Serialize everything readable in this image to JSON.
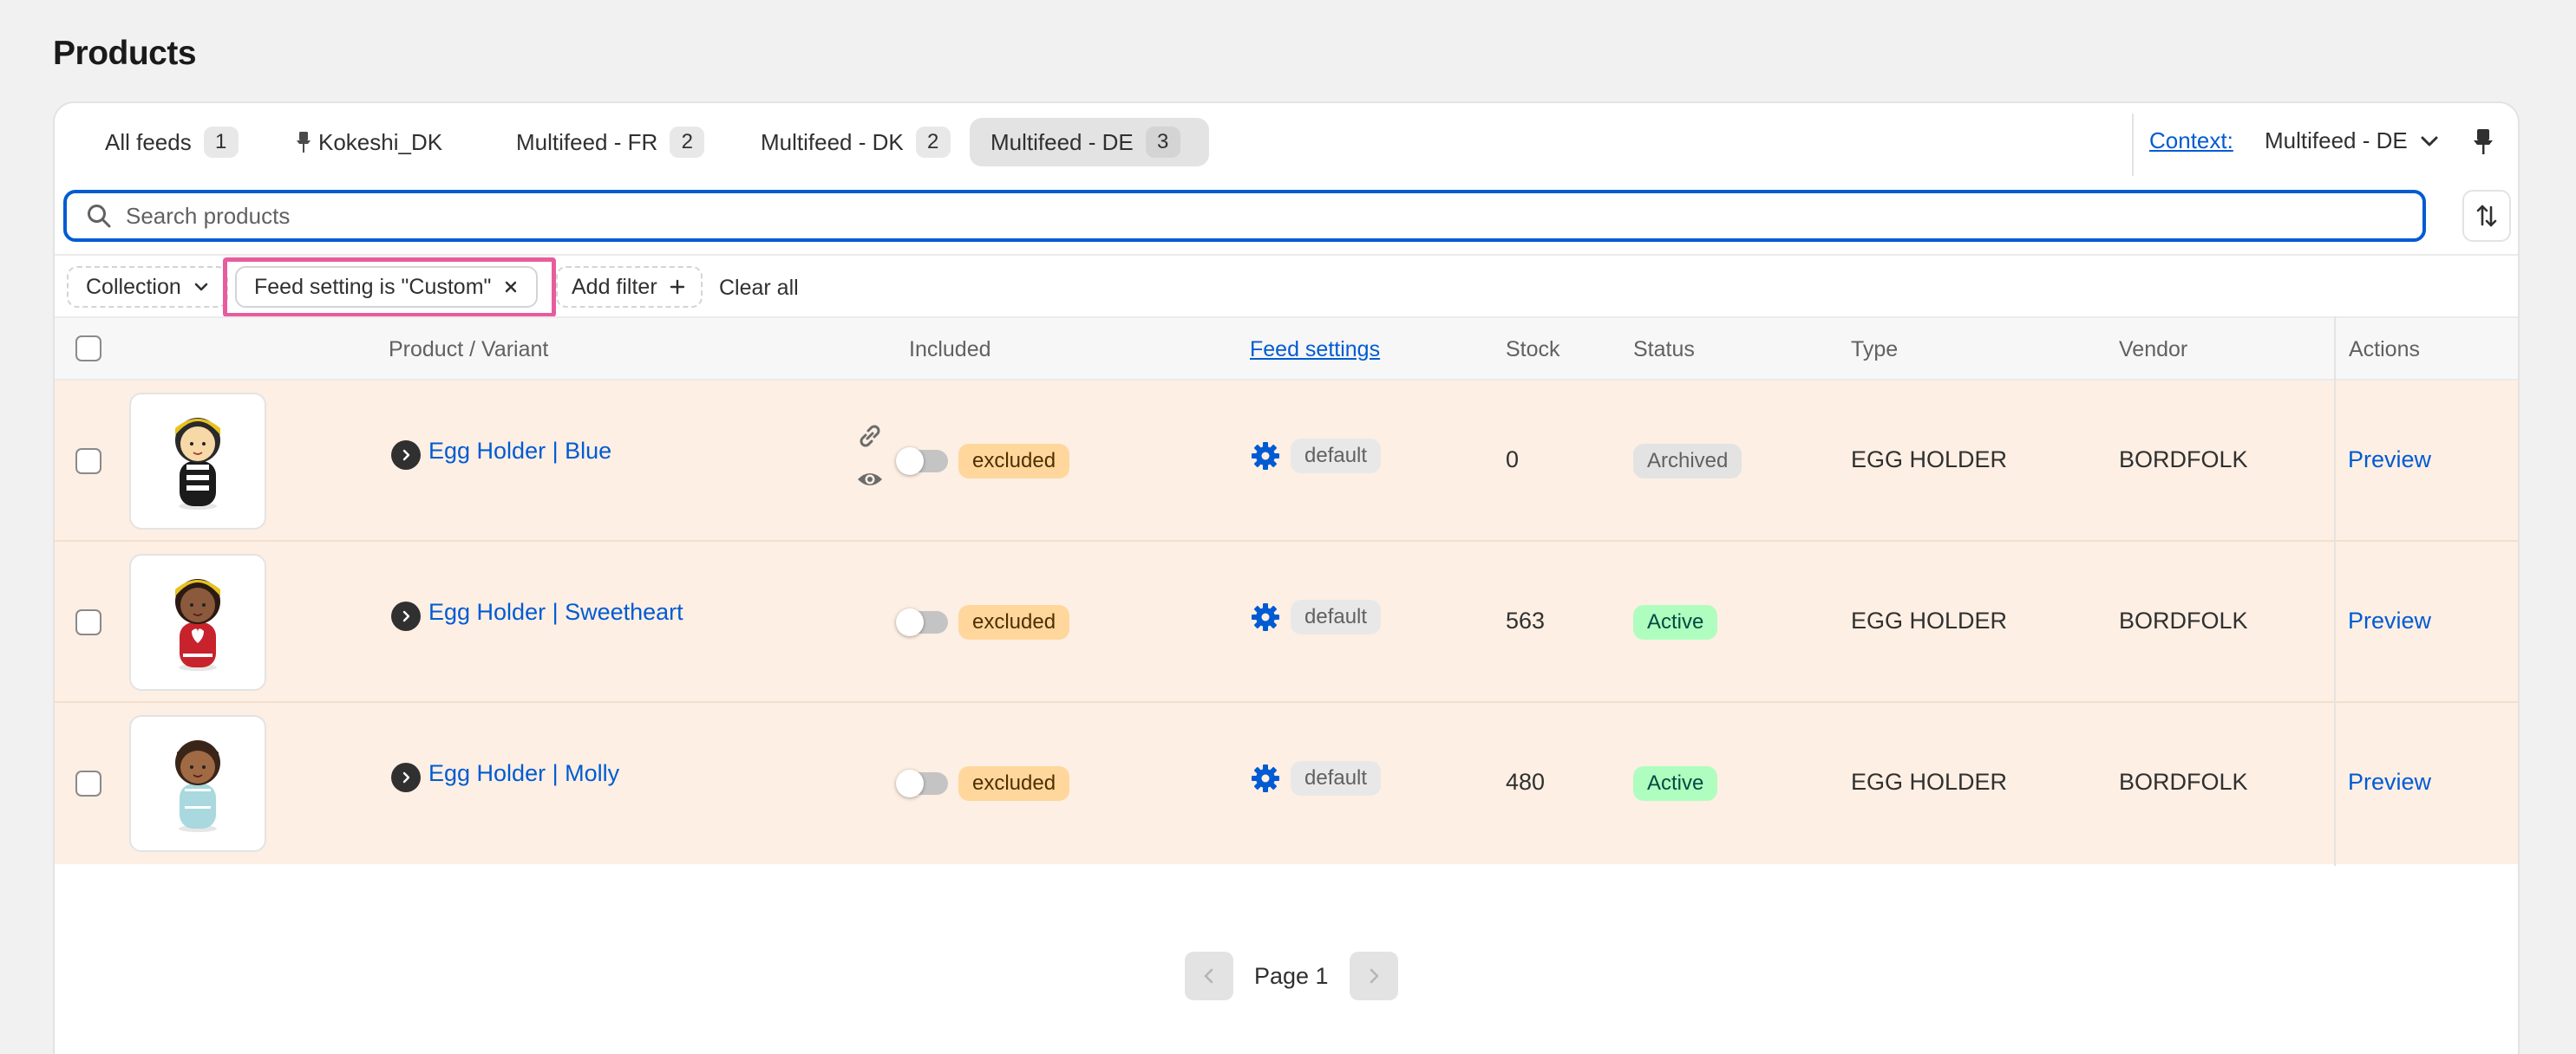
{
  "page": {
    "title": "Products"
  },
  "tabs": [
    {
      "label": "All feeds",
      "count": "1"
    },
    {
      "label": "Kokeshi_DK",
      "pinned": true
    },
    {
      "label": "Multifeed - FR",
      "count": "2"
    },
    {
      "label": "Multifeed - DK",
      "count": "2"
    },
    {
      "label": "Multifeed - DE",
      "count": "3",
      "active": true
    }
  ],
  "context": {
    "label": "Context:",
    "value": "Multifeed - DE"
  },
  "search": {
    "placeholder": "Search products",
    "value": ""
  },
  "filters": {
    "collection": "Collection",
    "applied": "Feed setting is \"Custom\"",
    "add_filter": "Add filter",
    "clear_all": "Clear all",
    "highlight_color": "#e75c9c"
  },
  "table": {
    "headers": {
      "product": "Product / Variant",
      "included": "Included",
      "feed_settings": "Feed settings",
      "stock": "Stock",
      "status": "Status",
      "type": "Type",
      "vendor": "Vendor",
      "actions": "Actions"
    },
    "rows": [
      {
        "name": "Egg Holder | Blue",
        "included": "excluded",
        "feed_setting": "default",
        "stock": "0",
        "status": "Archived",
        "type": "EGG HOLDER",
        "vendor": "BORDFOLK",
        "action": "Preview",
        "has_link_icons": true,
        "figure_colors": {
          "hair": "#2a2a2a",
          "face": "#f7d9a8",
          "hat": "#e8c21f",
          "body": "#1b1b1b",
          "accent": "#ffffff"
        }
      },
      {
        "name": "Egg Holder | Sweetheart",
        "included": "excluded",
        "feed_setting": "default",
        "stock": "563",
        "status": "Active",
        "type": "EGG HOLDER",
        "vendor": "BORDFOLK",
        "action": "Preview",
        "has_link_icons": false,
        "figure_colors": {
          "hair": "#2a1a12",
          "face": "#8b5a3c",
          "hat": "#e8c21f",
          "body": "#c8232c",
          "accent": "#ffffff"
        }
      },
      {
        "name": "Egg Holder | Molly",
        "included": "excluded",
        "feed_setting": "default",
        "stock": "480",
        "status": "Active",
        "type": "EGG HOLDER",
        "vendor": "BORDFOLK",
        "action": "Preview",
        "has_link_icons": false,
        "figure_colors": {
          "hair": "#3a2518",
          "face": "#a06a45",
          "hat": "#3a2518",
          "body": "#a9d8df",
          "accent": "#ffffff"
        }
      }
    ],
    "row_background": "#fdefe3"
  },
  "pagination": {
    "label": "Page 1"
  },
  "colors": {
    "link": "#005bd3",
    "badge_excluded": "#ffd79d",
    "badge_active": "#affebf"
  }
}
